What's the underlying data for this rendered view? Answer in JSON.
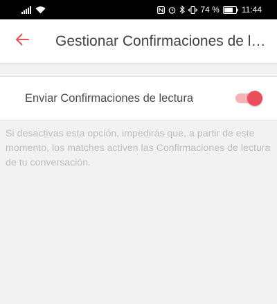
{
  "status_bar": {
    "battery_percent": "74 %",
    "time": "11:44",
    "icons": [
      "signal-icon",
      "wifi-icon",
      "nfc-icon",
      "alarm-icon",
      "bluetooth-icon",
      "vibrate-icon",
      "battery-icon"
    ]
  },
  "header": {
    "back_icon": "arrow-left-icon",
    "title": "Gestionar Confirmaciones de lectura"
  },
  "setting": {
    "label": "Enviar Confirmaciones de lectura",
    "enabled": true
  },
  "description": "Si desactivas esta opción, impedirás que, a partir de este momento, los matches activen las Confirmaciones de lectura de tu conversación.",
  "colors": {
    "accent": "#ea4f5b",
    "accent_track": "#f6b3b6",
    "title_text": "#424242",
    "description_text": "#bdbdbd",
    "background": "#f2f2f2"
  }
}
